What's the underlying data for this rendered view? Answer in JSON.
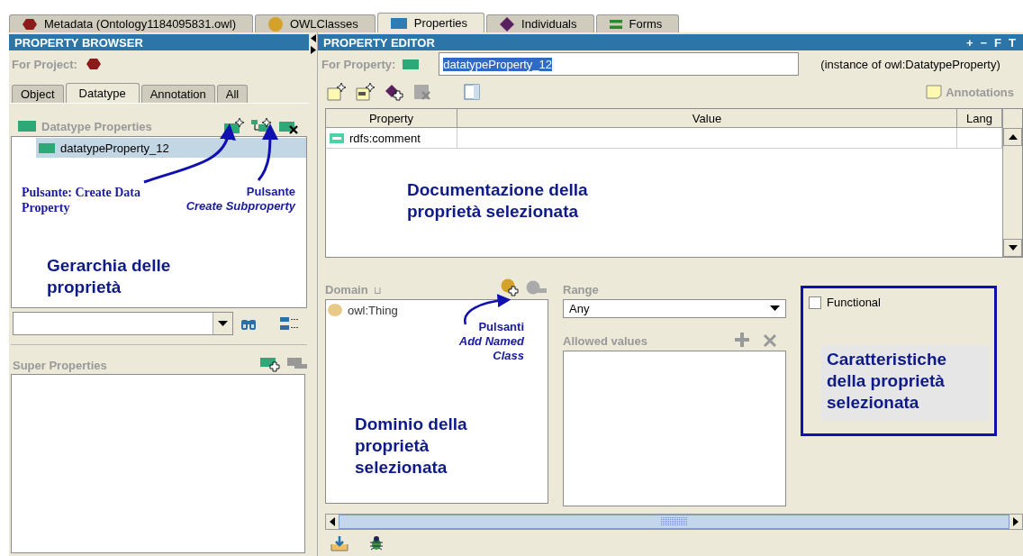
{
  "tabs": [
    {
      "label": "Metadata (Ontology1184095831.owl)",
      "kind": "metadata",
      "selected": false
    },
    {
      "label": "OWLClasses",
      "kind": "class",
      "selected": false
    },
    {
      "label": "Properties",
      "kind": "property",
      "selected": true
    },
    {
      "label": "Individuals",
      "kind": "individual",
      "selected": false
    },
    {
      "label": "Forms",
      "kind": "form",
      "selected": false
    }
  ],
  "property_browser": {
    "title": "PROPERTY BROWSER",
    "for_project_label": "For Project:",
    "subtabs": [
      {
        "label": "Object",
        "selected": false
      },
      {
        "label": "Datatype",
        "selected": true
      },
      {
        "label": "Annotation",
        "selected": false
      },
      {
        "label": "All",
        "selected": false
      }
    ],
    "section_title": "Datatype Properties",
    "tree": [
      {
        "label": "datatypeProperty_12",
        "selected": true
      }
    ],
    "super_properties_title": "Super Properties"
  },
  "property_editor": {
    "title": "PROPERTY EDITOR",
    "header_buttons": [
      "+",
      "−",
      "F",
      "T"
    ],
    "for_property_label": "For Property:",
    "property_name": "datatypeProperty_12",
    "instance_of": "(instance of owl:DatatypeProperty)",
    "annotations_label": "Annotations",
    "table": {
      "columns": [
        "Property",
        "Value",
        "Lang"
      ],
      "rows": [
        {
          "property": "rdfs:comment"
        }
      ]
    },
    "domain_title": "Domain",
    "domain_symbol": "⊔",
    "domain_items": [
      "owl:Thing"
    ],
    "range_title": "Range",
    "range_value": "Any",
    "allowed_values_title": "Allowed values",
    "functional": {
      "label": "Functional",
      "checked": false
    }
  },
  "callouts": [
    {
      "kind": "serif",
      "text": "Pulsante: Create Data Property"
    },
    {
      "kind": "sans",
      "text": "Pulsante *Create Subproperty*"
    },
    {
      "kind": "sans",
      "text": "Pulsanti *Add Named Class*"
    },
    {
      "kind": "big",
      "text": "Gerarchia delle proprietà"
    },
    {
      "kind": "big",
      "text": "Documentazione della proprietà selezionata"
    },
    {
      "kind": "big",
      "text": "Dominio della proprietà selezionata"
    },
    {
      "kind": "big",
      "text": "Caratteristiche della proprietà selezionata"
    }
  ]
}
